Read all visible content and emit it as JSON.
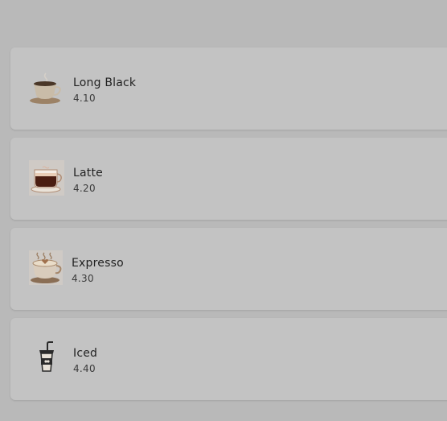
{
  "items": [
    {
      "name": "Long Black",
      "price": "4.10",
      "icon": "hot-coffee-cup-icon"
    },
    {
      "name": "Latte",
      "price": "4.20",
      "icon": "latte-glass-icon"
    },
    {
      "name": "Expresso",
      "price": "4.30",
      "icon": "espresso-cup-icon"
    },
    {
      "name": "Iced",
      "price": "4.40",
      "icon": "iced-coffee-cup-icon"
    }
  ],
  "colors": {
    "background": "#b9b9b9",
    "card": "#c3c3c3",
    "text": "#222222"
  }
}
